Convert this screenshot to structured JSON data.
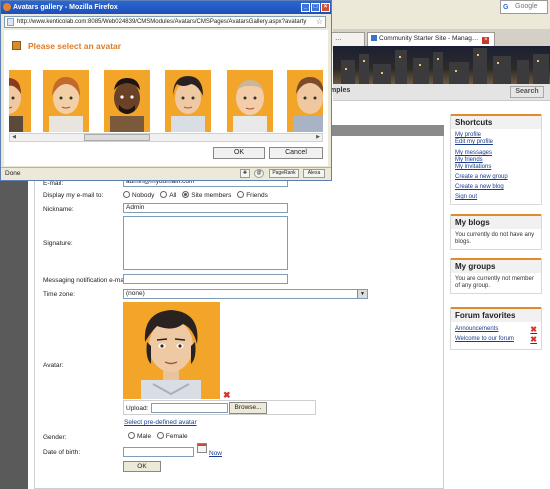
{
  "popup": {
    "window_title": "Avatars gallery - Mozilla Firefox",
    "url": "http://www.kenticolab.com:8085/Web024839/CMSModules/Avatars/CMSPages/AvatarsGallery.aspx?avatarty",
    "heading": "Please select an avatar",
    "ok_label": "OK",
    "cancel_label": "Cancel",
    "status": "Done",
    "status_buttons": [
      "PageRank",
      "Alexa"
    ]
  },
  "browser": {
    "tabs": [
      {
        "label": "…",
        "active": false
      },
      {
        "label": "Community Starter Site - Manag…",
        "active": true
      }
    ],
    "search_placeholder": "Google",
    "nav_item": "mples",
    "search_button": "Search"
  },
  "form": {
    "email_label": "E-mail:",
    "email_value": "admin@mydomain.com",
    "display_email_label": "Display my e-mail to:",
    "display_email_options": [
      "Nobody",
      "All",
      "Site members",
      "Friends"
    ],
    "display_email_selected": "Site members",
    "nickname_label": "Nickname:",
    "nickname_value": "Admin",
    "signature_label": "Signature:",
    "messaging_label": "Messaging notification e-mail:",
    "timezone_label": "Time zone:",
    "timezone_value": "(none)",
    "avatar_label": "Avatar:",
    "upload_label": "Upload:",
    "browse_label": "Browse...",
    "predefined_link": "Select pre-defined avatar",
    "gender_label": "Gender:",
    "gender_options": [
      "Male",
      "Female"
    ],
    "dob_label": "Date of birth:",
    "now_label": "Now",
    "ok_label": "OK"
  },
  "sidebar": {
    "shortcuts": {
      "title": "Shortcuts",
      "links": [
        "My profile",
        "Edit my profile",
        "My messages",
        "My friends",
        "My invitations",
        "Create a new group",
        "Create a new blog",
        "Sign out"
      ]
    },
    "blogs": {
      "title": "My blogs",
      "text": "You currently do not have any blogs."
    },
    "groups": {
      "title": "My groups",
      "text": "You are currently not member of any group."
    },
    "favorites": {
      "title": "Forum favorites",
      "items": [
        "Announcements",
        "Welcome to our forum"
      ]
    }
  },
  "colors": {
    "accent": "#e07b22",
    "avatar_bg": "#f3a52a",
    "link": "#1a3c8f"
  }
}
